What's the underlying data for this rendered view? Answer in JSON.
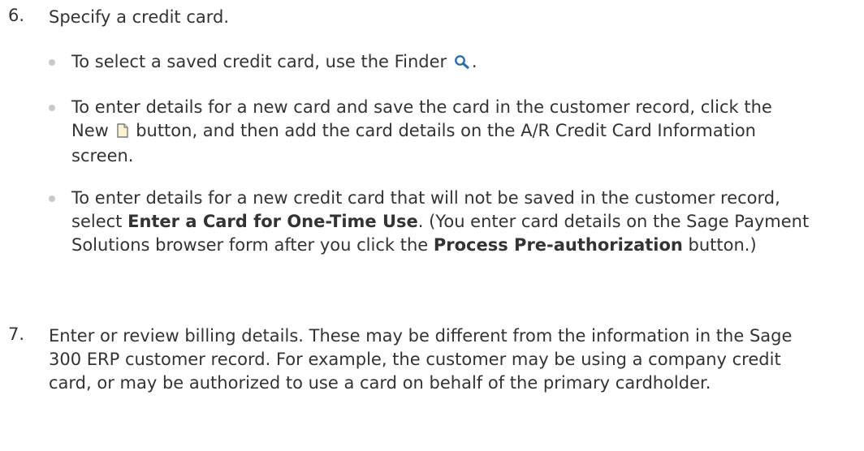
{
  "step6": {
    "number": "6.",
    "text": "Specify a credit card."
  },
  "bullets": [
    {
      "text_a": "To select a saved credit card, use the Finder",
      "text_b": "."
    },
    {
      "text_a": "To enter details for a new card and save the card in the customer record, click the New",
      "text_b": "button, and then add the card details on the A/R Credit Card Information screen."
    },
    {
      "text_a": "To enter details for a new credit card that will not be saved in the customer record, select",
      "bold_a": "Enter a Card for One-Time Use",
      "text_b": ". (You enter card details on the Sage Payment Solutions browser form after you click the",
      "bold_b": "Process Pre-authorization",
      "text_c": "button.)"
    }
  ],
  "step7": {
    "number": "7.",
    "text": "Enter or review billing details. These may be different from the information in the Sage 300 ERP customer record. For example, the customer may be using a company credit card, or may be authorized to use a card on behalf of the primary cardholder."
  },
  "icons": {
    "finder": "magnifier-icon",
    "new": "new-document-icon"
  }
}
